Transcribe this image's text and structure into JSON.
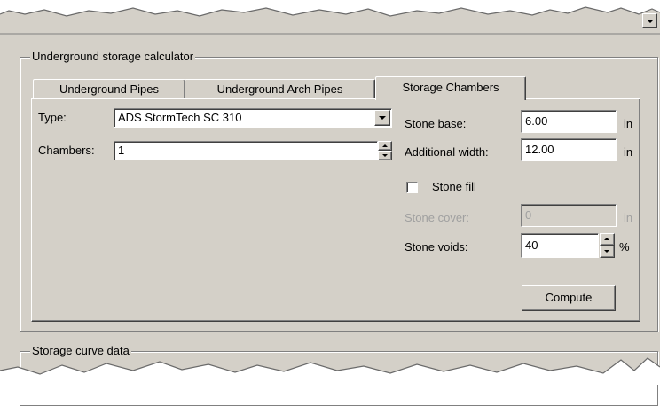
{
  "calculator": {
    "title": "Underground storage calculator",
    "tabs": [
      {
        "label": "Underground Pipes"
      },
      {
        "label": "Underground Arch Pipes"
      },
      {
        "label": "Storage Chambers"
      }
    ],
    "type": {
      "label": "Type:",
      "value": "ADS StormTech SC 310"
    },
    "chambers": {
      "label": "Chambers:",
      "value": "1"
    },
    "stone_base": {
      "label": "Stone base:",
      "value": "6.00",
      "unit": "in"
    },
    "additional_width": {
      "label": "Additional width:",
      "value": "12.00",
      "unit": "in"
    },
    "stone_fill": {
      "label": "Stone fill",
      "checked": false
    },
    "stone_cover": {
      "label": "Stone cover:",
      "value": "0",
      "unit": "in"
    },
    "stone_voids": {
      "label": "Stone voids:",
      "value": "40",
      "unit": "%"
    },
    "compute_label": "Compute"
  },
  "storage_curve": {
    "title": "Storage curve data"
  }
}
